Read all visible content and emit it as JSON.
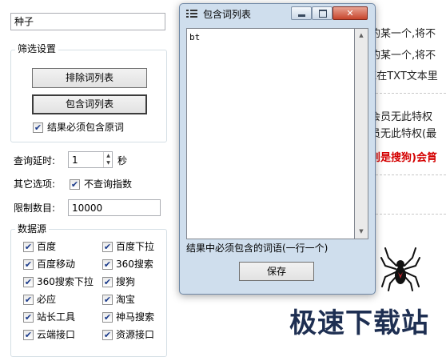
{
  "seed_input": {
    "value": "种子"
  },
  "filter": {
    "title": "筛选设置",
    "exclude_button": "排除词列表",
    "include_button": "包含词列表",
    "must_include_label": "结果必须包含原词",
    "must_include_checked": true
  },
  "query_delay": {
    "label": "查询延时:",
    "value": "1",
    "unit": "秒"
  },
  "other_options": {
    "label": "其它选项:",
    "no_index_label": "不查询指数",
    "no_index_checked": true
  },
  "limit_count": {
    "label": "限制数目:",
    "value": "10000"
  },
  "sources": {
    "title": "数据源",
    "items": [
      {
        "label": "百度",
        "checked": true
      },
      {
        "label": "百度下拉",
        "checked": true
      },
      {
        "label": "百度移动",
        "checked": true
      },
      {
        "label": "360搜索",
        "checked": true
      },
      {
        "label": "360搜索下拉",
        "checked": true
      },
      {
        "label": "搜狗",
        "checked": true
      },
      {
        "label": "必应",
        "checked": true
      },
      {
        "label": "淘宝",
        "checked": true
      },
      {
        "label": "站长工具",
        "checked": true
      },
      {
        "label": "神马搜索",
        "checked": true
      },
      {
        "label": "云端接口",
        "checked": true
      },
      {
        "label": "资源接口",
        "checked": true
      }
    ]
  },
  "background_text": {
    "line1": "的某一个,将不",
    "line2": "的某一个,将不",
    "line3": "E在TXT文本里",
    "line4": "会员无此特权",
    "line5": "员无此特权(最",
    "line6": "则是搜狗)会筲"
  },
  "dialog": {
    "title": "包含词列表",
    "list_text": "bt",
    "hint": "结果中必须包含的词语(一行一个)",
    "save_button": "保存"
  },
  "watermark": "极速下载站",
  "colors": {
    "red_text": "#d40000",
    "dialog_frame": "#cfdeed",
    "close_button": "#c7452c"
  }
}
